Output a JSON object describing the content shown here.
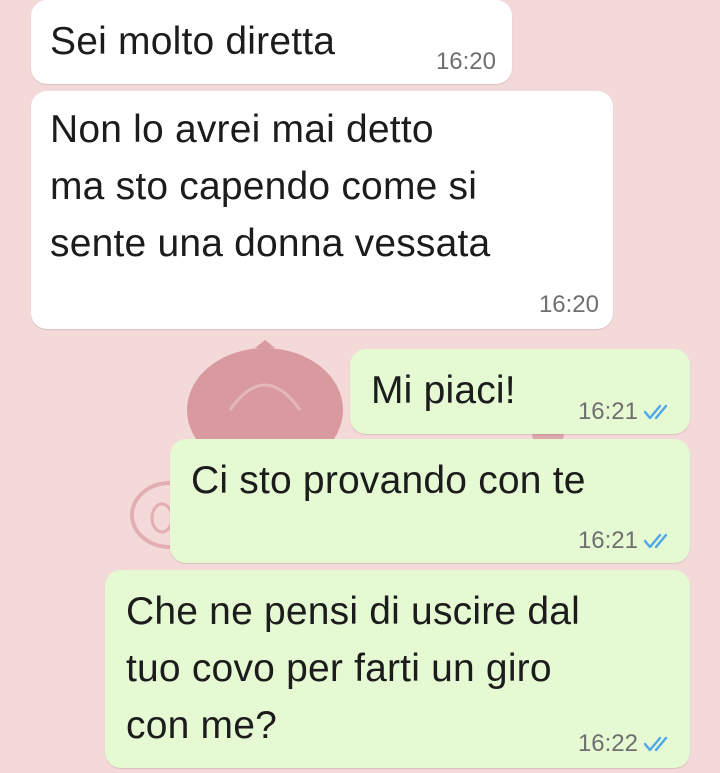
{
  "colors": {
    "background": "#f4d9d9",
    "incoming_bubble": "#ffffff",
    "outgoing_bubble": "#e5f9d3",
    "read_ticks": "#4fa7ea"
  },
  "messages": [
    {
      "direction": "incoming",
      "text": "Sei molto diretta",
      "time": "16:20"
    },
    {
      "direction": "incoming",
      "text": "Non lo avrei mai detto\nma sto capendo come si\nsente una donna vessata",
      "time": "16:20"
    },
    {
      "direction": "outgoing",
      "text": "Mi piaci!",
      "time": "16:21",
      "status_icon": "double-check-read-icon"
    },
    {
      "direction": "outgoing",
      "text": "Ci sto provando con te",
      "time": "16:21",
      "status_icon": "double-check-read-icon"
    },
    {
      "direction": "outgoing",
      "text": "Che ne pensi di uscire dal\ntuo covo per farti un giro\ncon me?",
      "time": "16:22",
      "status_icon": "double-check-read-icon"
    }
  ]
}
